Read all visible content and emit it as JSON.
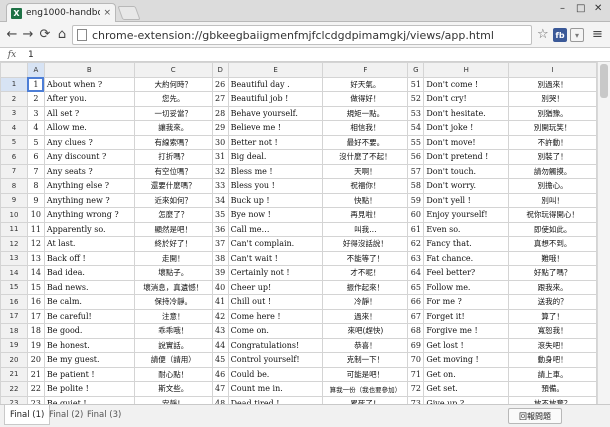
{
  "browser": {
    "tab_title": "eng1000-handbook.xls",
    "tab_close": "×",
    "url": "chrome-extension://gbkeegbaiigmenfmjfclcdgdpimamgkj/views/app.html",
    "window_controls": [
      "–",
      "□",
      "✕"
    ],
    "nav": {
      "back": "←",
      "forward": "→",
      "reload": "⟳",
      "home": "⌂"
    },
    "star": "☆",
    "menu": "≡",
    "extensions": [
      {
        "name": "fb-extension-icon",
        "label": "fb",
        "color": "#3b5998"
      },
      {
        "name": "shield-extension-icon",
        "label": "▾",
        "color": "#7a7a7a"
      },
      {
        "name": "puzzle-extension-icon",
        "label": "◈",
        "color": "#b84c4c"
      }
    ],
    "accent_color": "#1e7145"
  },
  "formula": {
    "fx": "fx",
    "value": "1"
  },
  "columns": [
    "A",
    "B",
    "C",
    "D",
    "E",
    "F",
    "G",
    "H",
    "I"
  ],
  "rows": [
    {
      "r": "1",
      "c": [
        "1",
        "About when ?",
        "大約何時？",
        "26",
        "Beautiful day .",
        "好天氣。",
        "51",
        "Don't come !",
        "別過來！"
      ]
    },
    {
      "r": "2",
      "c": [
        "2",
        "After you.",
        "您先。",
        "27",
        "Beautiful job !",
        "做得好！",
        "52",
        "Don't cry!",
        "別哭！"
      ]
    },
    {
      "r": "3",
      "c": [
        "3",
        "All set ?",
        "一切妥當？",
        "28",
        "Behave yourself.",
        "規矩一點。",
        "53",
        "Don't hesitate.",
        "別猶豫。"
      ]
    },
    {
      "r": "4",
      "c": [
        "4",
        "Allow me.",
        "讓我來。",
        "29",
        "Believe me !",
        "相信我！",
        "54",
        "Don't joke !",
        "別開玩笑！"
      ]
    },
    {
      "r": "5",
      "c": [
        "5",
        "Any clues ?",
        "有線索嗎？",
        "30",
        "Better not !",
        "最好不要。",
        "55",
        "Don't move!",
        "不許動！"
      ]
    },
    {
      "r": "6",
      "c": [
        "6",
        "Any discount ?",
        "打折嗎？",
        "31",
        "Big deal.",
        "沒什麼了不起！",
        "56",
        "Don't pretend !",
        "別裝了！"
      ]
    },
    {
      "r": "7",
      "c": [
        "7",
        "Any seats ?",
        "有空位嗎？",
        "32",
        "Bless me !",
        "天啊！",
        "57",
        "Don't touch.",
        "請勿觸摸。"
      ]
    },
    {
      "r": "8",
      "c": [
        "8",
        "Anything else ?",
        "還要什麼嗎？",
        "33",
        "Bless you !",
        "祝福你！",
        "58",
        "Don't worry.",
        "別擔心。"
      ]
    },
    {
      "r": "9",
      "c": [
        "9",
        "Anything new ?",
        "近來如何？",
        "34",
        "Buck up !",
        "快點！",
        "59",
        "Don't yell !",
        "別叫！"
      ]
    },
    {
      "r": "10",
      "c": [
        "10",
        "Anything wrong ?",
        "怎麼了？",
        "35",
        "Bye now !",
        "再見啦！",
        "60",
        "Enjoy yourself!",
        "祝你玩得開心！"
      ]
    },
    {
      "r": "11",
      "c": [
        "11",
        "Apparently so.",
        "顯然是吧！",
        "36",
        "Call me…",
        "叫我…",
        "61",
        "Even so.",
        "即使如此。"
      ]
    },
    {
      "r": "12",
      "c": [
        "12",
        "At last.",
        "終於好了！",
        "37",
        "Can't complain.",
        "好得沒話說！",
        "62",
        "Fancy that.",
        "真想不到。"
      ]
    },
    {
      "r": "13",
      "c": [
        "13",
        "Back off !",
        "走開！",
        "38",
        "Can't wait !",
        "不能等了！",
        "63",
        "Fat chance.",
        "難哦！"
      ]
    },
    {
      "r": "14",
      "c": [
        "14",
        "Bad idea.",
        "壞點子。",
        "39",
        "Certainly not !",
        "才不呢！",
        "64",
        "Feel better?",
        "好點了嗎？"
      ]
    },
    {
      "r": "15",
      "c": [
        "15",
        "Bad news.",
        "壞消息，真遺憾！",
        "40",
        "Cheer up!",
        "振作起來！",
        "65",
        "Follow me.",
        "跟我來。"
      ]
    },
    {
      "r": "16",
      "c": [
        "16",
        "Be calm.",
        "保持冷靜。",
        "41",
        "Chill out !",
        "冷靜！",
        "66",
        "For me ?",
        "送我的？"
      ]
    },
    {
      "r": "17",
      "c": [
        "17",
        "Be careful!",
        "注意！",
        "42",
        "Come here !",
        "過來！",
        "67",
        "Forget it!",
        "算了！"
      ]
    },
    {
      "r": "18",
      "c": [
        "18",
        "Be good.",
        "乖乖哦！",
        "43",
        "Come on.",
        "來吧(趕快)",
        "68",
        "Forgive me !",
        "寬恕我！"
      ]
    },
    {
      "r": "19",
      "c": [
        "19",
        "Be honest.",
        "說實話。",
        "44",
        "Congratulations!",
        "恭喜！",
        "69",
        "Get lost !",
        "滾失吧！"
      ]
    },
    {
      "r": "20",
      "c": [
        "20",
        "Be my guest.",
        "請便（請用）",
        "45",
        "Control yourself!",
        "克制一下！",
        "70",
        "Get moving !",
        "動身吧！"
      ]
    },
    {
      "r": "21",
      "c": [
        "21",
        "Be patient !",
        "耐心點！",
        "46",
        "Could be.",
        "可能是吧！",
        "71",
        "Get on.",
        "請上車。"
      ]
    },
    {
      "r": "22",
      "c": [
        "22",
        "Be polite !",
        "斯文些。",
        "47",
        "Count me in.",
        "算我一份（我也要參加）",
        "72",
        "Get set.",
        "預備。"
      ]
    },
    {
      "r": "23",
      "c": [
        "23",
        "Be quiet !",
        "安靜！",
        "48",
        "Dead tired !",
        "累死了！",
        "73",
        "Give up ?",
        "放不放棄？"
      ]
    }
  ],
  "sheets": [
    "Final (1)",
    "Final (2)",
    "Final (3)"
  ],
  "report_button": "回報問題"
}
